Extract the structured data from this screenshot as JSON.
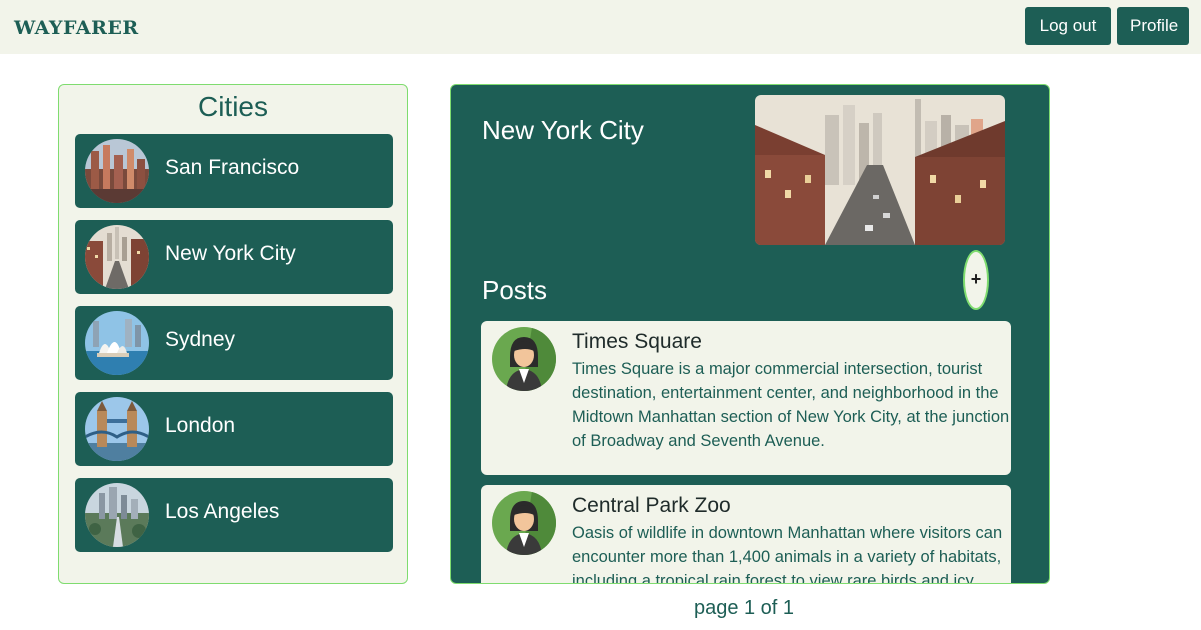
{
  "header": {
    "logo": "WAYFARER",
    "logout_label": "Log out",
    "profile_label": "Profile"
  },
  "cities_panel": {
    "title": "Cities",
    "items": [
      {
        "label": "San Francisco"
      },
      {
        "label": "New York City"
      },
      {
        "label": "Sydney"
      },
      {
        "label": "London"
      },
      {
        "label": "Los Angeles"
      }
    ]
  },
  "city_detail": {
    "name": "New York City",
    "posts_heading": "Posts",
    "add_post_label": "+",
    "posts": [
      {
        "title": "Times Square",
        "body": "Times Square is a major commercial intersection, tourist destination, entertainment center, and neighborhood in the Midtown Manhattan section of New York City, at the junction of Broadway and Seventh Avenue."
      },
      {
        "title": "Central Park Zoo",
        "body": "Oasis of wildlife in downtown Manhattan where visitors can encounter more than 1,400 animals in a variety of habitats, including a tropical rain forest to view rare birds and icy"
      }
    ]
  },
  "pagination": {
    "label": "page 1 of 1"
  },
  "colors": {
    "brand": "#1d5e55",
    "panel_bg": "#f2f4ea",
    "accent_border": "#7fdc6f"
  }
}
